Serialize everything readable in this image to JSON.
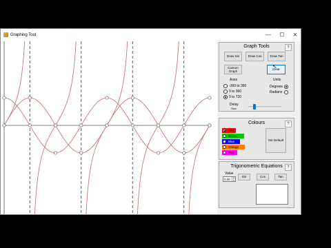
{
  "window": {
    "title": "Graphing Tool",
    "minimize": "—",
    "maximize": "☐",
    "close": "✕"
  },
  "graph_tools": {
    "title": "Graph Tools",
    "help": "?",
    "draw_sin": "Draw Sin",
    "draw_cos": "Draw Cos",
    "draw_tan": "Draw Tan",
    "custom_graph": "Custom Graph",
    "clear": "Clear",
    "axes_label": "Axes",
    "axes_options": [
      "-360 to 360",
      "0 to 360",
      "0 to 720"
    ],
    "axes_selected": 2,
    "units_label": "Units",
    "units_options": [
      "Degrees",
      "Radians"
    ],
    "units_selected": 0,
    "delay_label": "Delay",
    "delay_sub": "Size",
    "delay_value": 0.15
  },
  "colours": {
    "title": "Colours",
    "help": "?",
    "options": [
      {
        "label": "Red",
        "color": "#ff0000"
      },
      {
        "label": "Green",
        "color": "#00cc00"
      },
      {
        "label": "Blue",
        "color": "#0000ff"
      },
      {
        "label": "Orange",
        "color": "#ff8000"
      },
      {
        "label": "Pink",
        "color": "#ff00ff"
      }
    ],
    "selected": 0,
    "set_default": "Set Default"
  },
  "trig": {
    "title": "Trigonometric Equations",
    "help": "?",
    "value_label": "Value",
    "value": "0.00",
    "sin": "Sin",
    "cos": "Cos",
    "tan": "Tan",
    "result": ""
  },
  "graph": {
    "line_color": "#c87878",
    "axes": "0 to 720",
    "units": "Degrees",
    "functions_drawn": [
      "sin",
      "cos",
      "tan"
    ]
  }
}
